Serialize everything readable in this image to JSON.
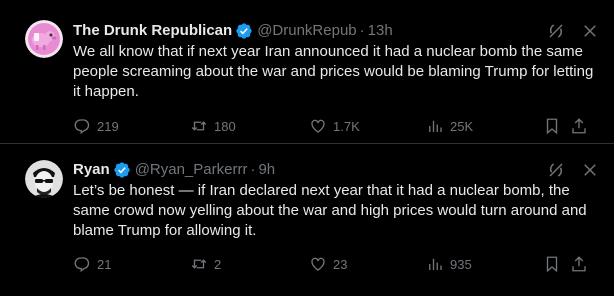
{
  "tweets": [
    {
      "name": "The Drunk Republican",
      "handle": "@DrunkRepub",
      "separator": "·",
      "time": "13h",
      "text": "We all know that if next year Iran announced it had a nuclear bomb the same people screaming about the war and prices would be blaming Trump for letting it happen.",
      "replies": "219",
      "reposts": "180",
      "likes": "1.7K",
      "views": "25K",
      "avatar_color": "#e98bd3"
    },
    {
      "name": "Ryan",
      "handle": "@Ryan_Parkerrr",
      "separator": "·",
      "time": "9h",
      "text": "Let’s be honest — if Iran declared next year that it had a nuclear bomb, the same crowd now yelling about the war and high prices would turn around and blame Trump for allowing it.",
      "replies": "21",
      "reposts": "2",
      "likes": "23",
      "views": "935",
      "avatar_color": "#d9d9d9"
    }
  ],
  "colors": {
    "background": "#000000",
    "text": "#e7e9ea",
    "muted": "#71767b",
    "verified": "#1d9bf0",
    "divider": "#2f3336"
  },
  "icons": [
    "grok-icon",
    "close-icon",
    "reply-icon",
    "repost-icon",
    "like-icon",
    "views-icon",
    "bookmark-icon",
    "share-icon",
    "verified-badge-icon"
  ]
}
